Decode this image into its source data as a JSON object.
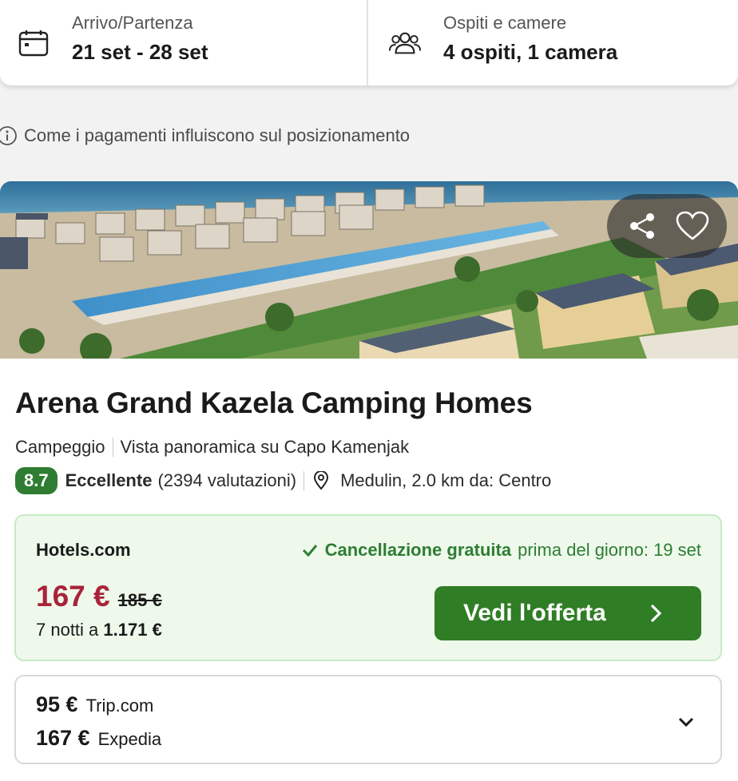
{
  "search": {
    "dates_label": "Arrivo/Partenza",
    "dates_value": "21 set - 28 set",
    "guests_label": "Ospiti e camere",
    "guests_value": "4 ospiti, 1 camera"
  },
  "info_text": "Come i pagamenti influiscono sul posizionamento",
  "hotel": {
    "name": "Arena Grand Kazela Camping Homes",
    "type": "Campeggio",
    "feature": "Vista panoramica su Capo Kamenjak",
    "rating": "8.7",
    "rating_label": "Eccellente",
    "reviews": "(2394 valutazioni)",
    "location": "Medulin, 2.0 km da: Centro"
  },
  "offer": {
    "provider": "Hotels.com",
    "cancel_strong": "Cancellazione gratuita",
    "cancel_rest": "prima del giorno: 19 set",
    "price": "167 €",
    "old_price": "185 €",
    "nights_prefix": "7 notti a",
    "nights_total": "1.171 €",
    "cta_label": "Vedi l'offerta"
  },
  "other_offers": [
    {
      "amount": "95 €",
      "provider": "Trip.com"
    },
    {
      "amount": "167 €",
      "provider": "Expedia"
    }
  ],
  "colors": {
    "accent_green": "#2f7d24",
    "price_red": "#a8233a",
    "offer_bg": "#eef9ec"
  },
  "icons": [
    "calendar-icon",
    "guests-icon",
    "info-icon",
    "share-icon",
    "heart-icon",
    "map-pin-icon",
    "check-icon",
    "chevron-right-icon",
    "chevron-down-icon"
  ]
}
